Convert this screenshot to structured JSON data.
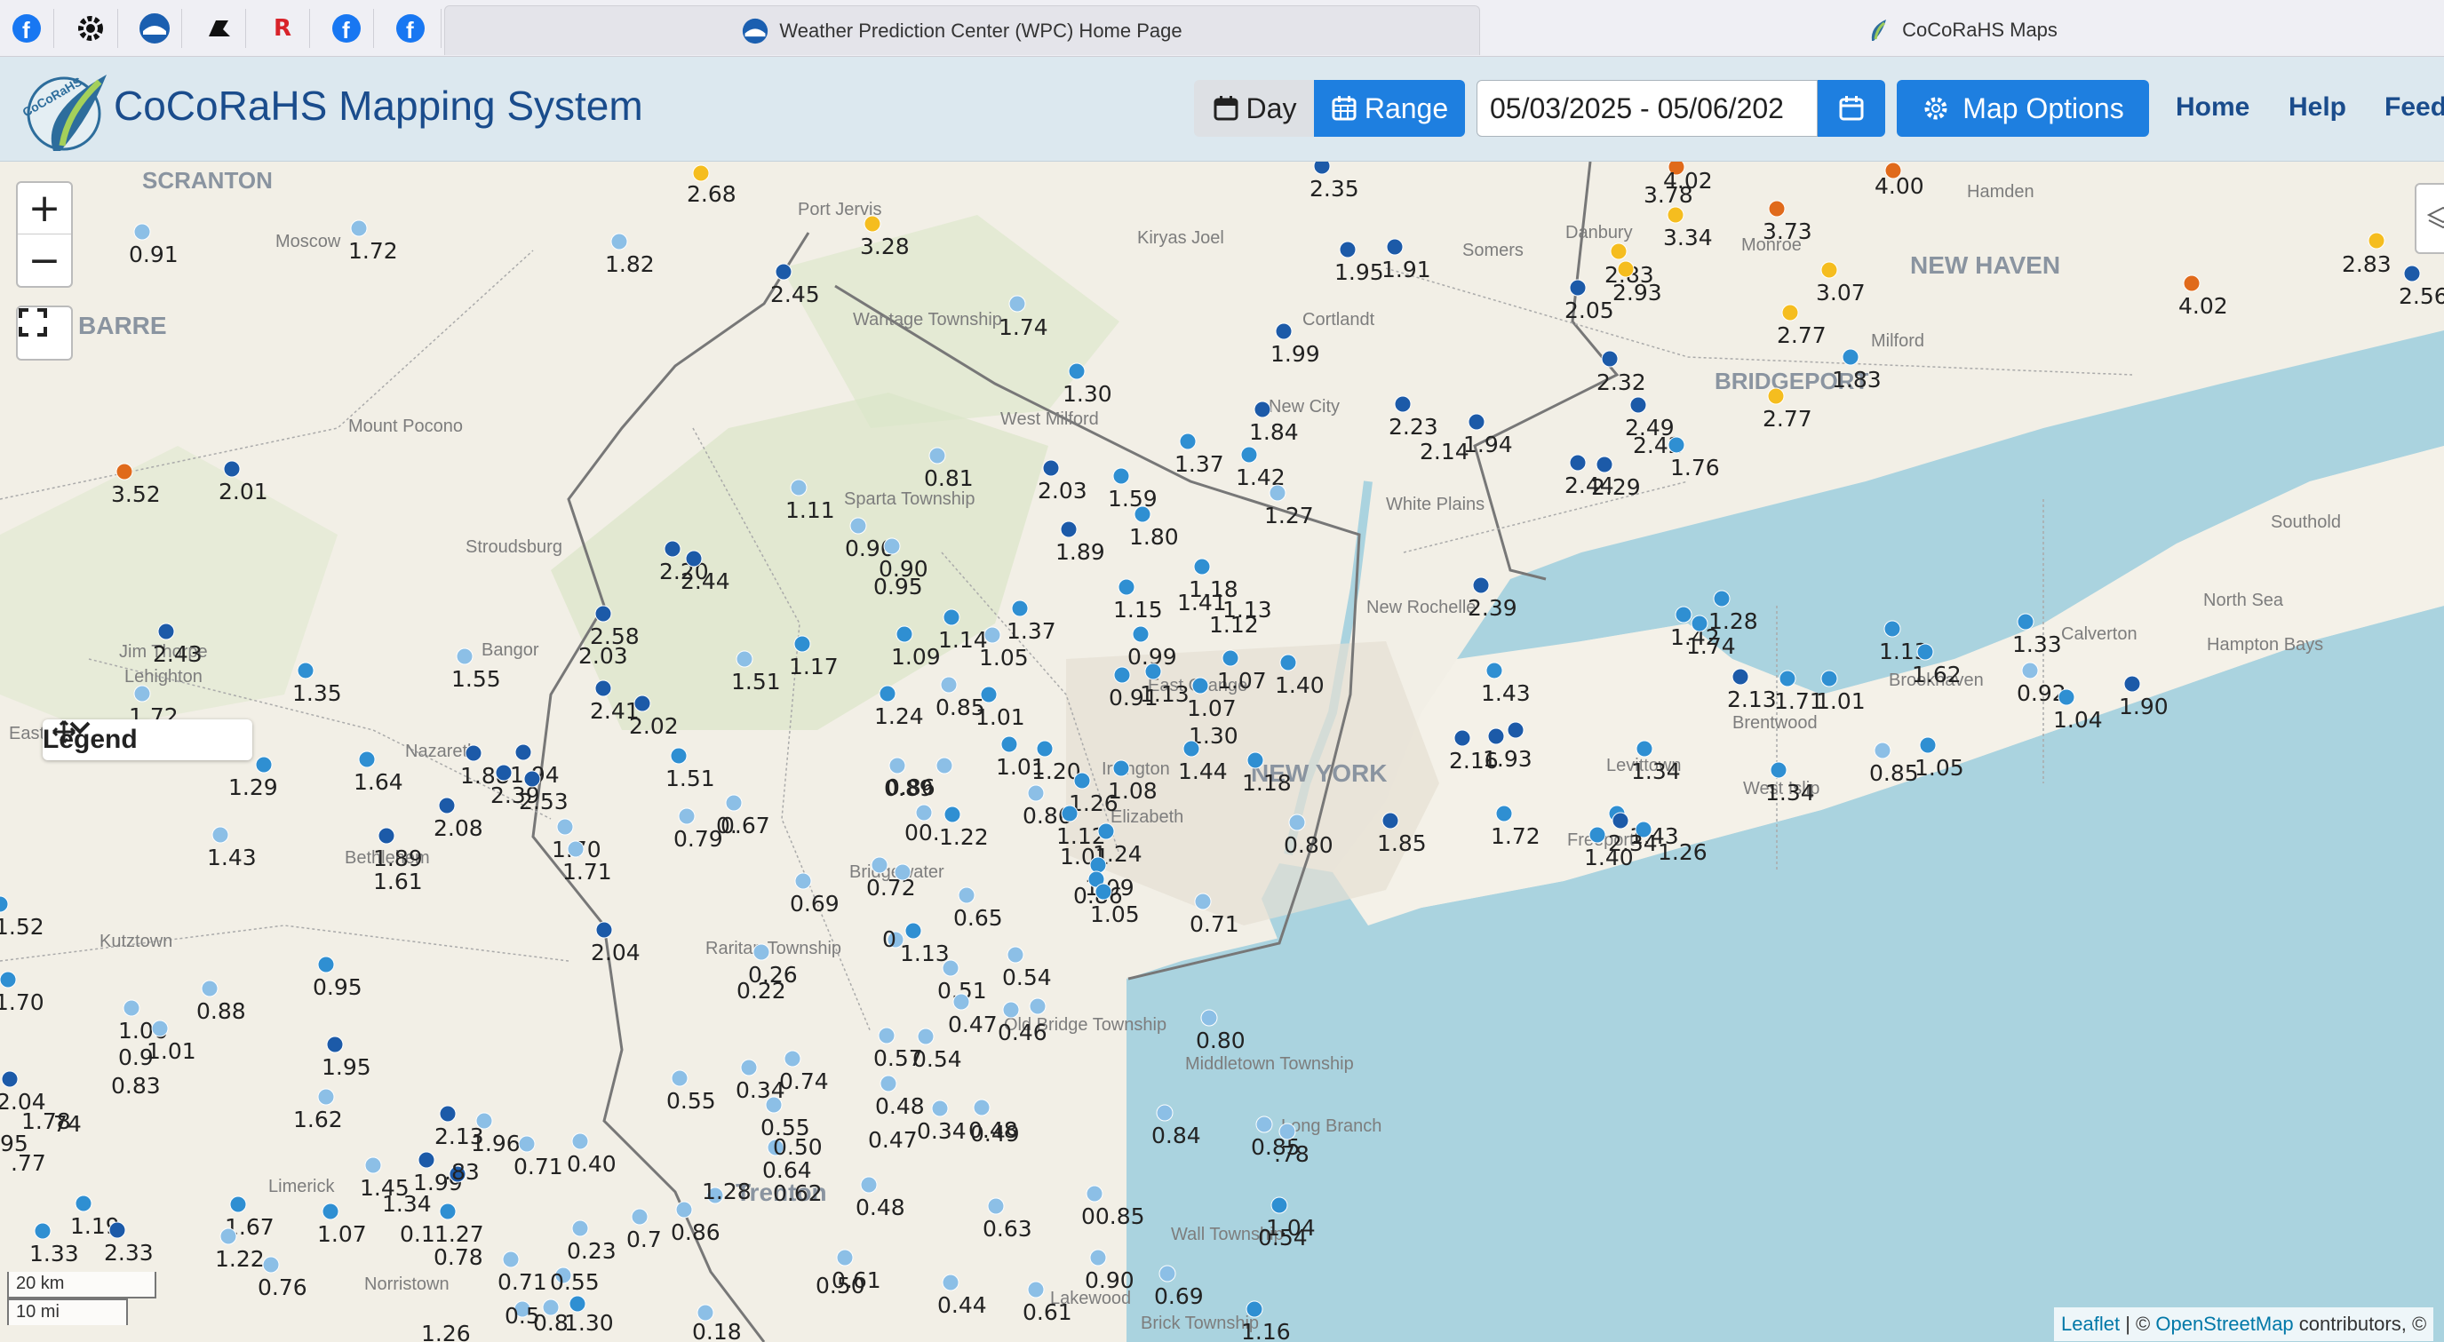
{
  "browser": {
    "tab_active_title": "Weather Prediction Center (WPC) Home Page",
    "tab_inactive_title": "CoCoRaHS Maps",
    "pinned_icons": [
      "facebook-icon",
      "gear-icon",
      "noaa-icon",
      "cutter-icon",
      "r-icon",
      "facebook-icon",
      "facebook-icon"
    ],
    "r_glyph": "R"
  },
  "app": {
    "title": "CoCoRaHS Mapping System",
    "logo_text": "CoCoRaHS",
    "btn_day": "Day",
    "btn_range": "Range",
    "date_range": "05/03/2025 - 05/06/202",
    "btn_options": "Map Options",
    "nav": [
      "Home",
      "Help",
      "Feedb"
    ]
  },
  "map": {
    "zoom_in": "+",
    "zoom_out": "−",
    "legend_label": "Legend",
    "scale_km": "20 km",
    "scale_mi": "10 mi",
    "attribution_leaflet": "Leaflet",
    "attribution_sep": "| ©",
    "attribution_osm": "OpenStreetMap",
    "attribution_tail": "contributors, ©",
    "place_labels": [
      "SCRANTON",
      "Moscow",
      "Port Jervis",
      "Kiryas Joel",
      "Danbury",
      "Hamden",
      "NEW HAVEN",
      "BARRE",
      "Wantage Township",
      "Somers",
      "Cortlandt",
      "Monroe",
      "Milford",
      "Mount Pocono",
      "West Milford",
      "New City",
      "BRIDGEPORT",
      "Sparta Township",
      "White Plains",
      "Southold",
      "Stroudsburg",
      "New Rochelle",
      "North Sea",
      "Calverton",
      "Hampton Bays",
      "Bangor",
      "Jim Thorpe",
      "Lehighton",
      "NEW YORK",
      "Brentwood",
      "Brookhaven",
      "Levittown",
      "West Islip",
      "Nazareth",
      "Bethlehem",
      "Freeport",
      "Kutztown",
      "Raritan Township",
      "Elizabeth",
      "Irvington",
      "East Orange",
      "Bridgewater",
      "Middletown Township",
      "Long Branch",
      "Trenton",
      "Wall Township",
      "Norristown",
      "Limerick",
      "Lakewood",
      "Brick Township",
      "Old Bridge Township",
      "Easton"
    ],
    "station_colors": {
      "light": "#8cbfe6",
      "medium": "#2f8fd2",
      "dark": "#1c5aa8",
      "yellow": "#f5bd1f",
      "orange": "#e06a1b"
    }
  }
}
